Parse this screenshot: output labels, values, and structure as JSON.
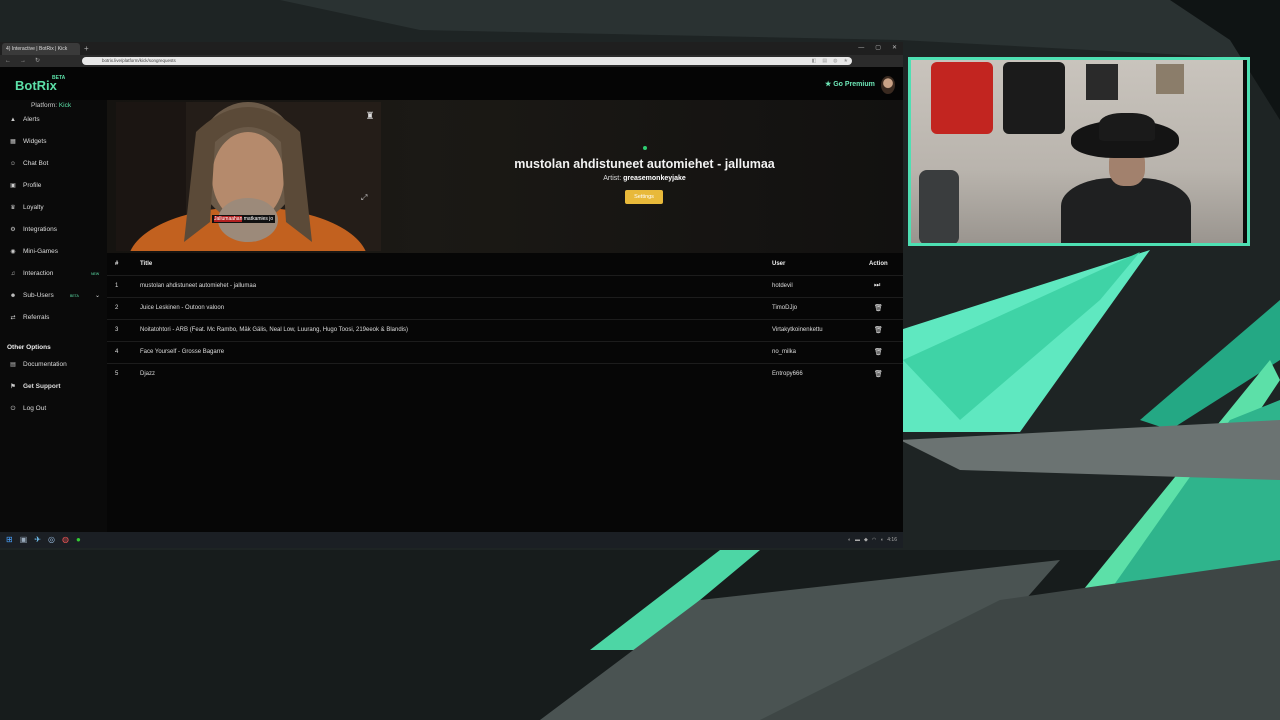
{
  "browser": {
    "tab_title": "4) Interactive | BotRix | Kick",
    "url": "botrix.live/platform/kick/songrequests"
  },
  "app": {
    "logo": "BotRix",
    "logo_badge": "BETA",
    "go_premium": "Go Premium",
    "platform_label": "Platform:",
    "platform_value": "Kick"
  },
  "sidebar": {
    "items": [
      {
        "label": "Alerts",
        "icon": "alert-icon"
      },
      {
        "label": "Widgets",
        "icon": "widgets-icon"
      },
      {
        "label": "Chat Bot",
        "icon": "robot-icon"
      },
      {
        "label": "Profile",
        "icon": "profile-icon"
      },
      {
        "label": "Loyalty",
        "icon": "trophy-icon"
      },
      {
        "label": "Integrations",
        "icon": "integrations-icon"
      },
      {
        "label": "Mini-Games",
        "icon": "gamepad-icon"
      },
      {
        "label": "Interaction",
        "icon": "music-icon",
        "badge": "NEW"
      },
      {
        "label": "Sub-Users",
        "icon": "users-icon",
        "badge": "BETA"
      },
      {
        "label": "Referrals",
        "icon": "referrals-icon"
      }
    ],
    "other_options_heading": "Other Options",
    "other_items": [
      {
        "label": "Documentation",
        "icon": "docs-icon"
      },
      {
        "label": "Get Support",
        "icon": "support-icon"
      },
      {
        "label": "Log Out",
        "icon": "logout-icon"
      }
    ]
  },
  "now_playing": {
    "cover_subtitle_highlight": "Jallumaahan",
    "cover_subtitle_rest": " matkamies jo",
    "title": "mustolan ahdistuneet automiehet - jallumaa",
    "artist_label": "Artist:",
    "artist": "greasemonkeyjake",
    "settings_label": "Settings"
  },
  "queue": {
    "headers": {
      "num": "#",
      "title": "Title",
      "user": "User",
      "action": "Action"
    },
    "rows": [
      {
        "num": "1",
        "title": "mustolan ahdistuneet automiehet - jallumaa",
        "user": "hotdevil",
        "action": "play"
      },
      {
        "num": "2",
        "title": "Juice Leskinen - Outoon valoon",
        "user": "TimoDJjo",
        "action": "delete"
      },
      {
        "num": "3",
        "title": "Noitatohtori - ARB (Feat. Mc Rambo, Mäk Gälis, Neal Low, Luurang, Hugo Toosi, 219eeok & Blandis)",
        "user": "Virtakytkoinenkettu",
        "action": "delete"
      },
      {
        "num": "4",
        "title": "Face Yourself - Grosse Bagarre",
        "user": "no_milka",
        "action": "delete"
      },
      {
        "num": "5",
        "title": "Djazz",
        "user": "Entropy666",
        "action": "delete"
      }
    ]
  },
  "taskbar": {
    "clock": "4:16"
  },
  "colors": {
    "accent": "#5ce0a8",
    "settings_button": "#e8b93a",
    "cam_border": "#4ee0b3"
  }
}
